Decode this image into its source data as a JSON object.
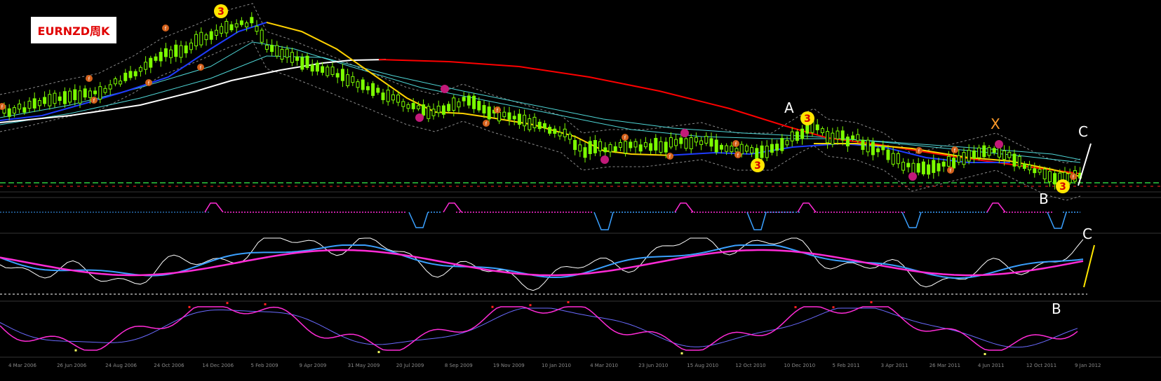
{
  "title": "EURNZD周K",
  "labels": {
    "A": "A",
    "B": "B",
    "C": "C",
    "X": "X",
    "three": "3"
  },
  "colors": {
    "background": "#000000",
    "candle": "#7CFC00",
    "blue_ma": "#1f3cff",
    "yellow_ma": "#ffd200",
    "white_ma": "#ffffff",
    "red_ma": "#ff0000",
    "cyan_band": "#4fd6d6",
    "envelope": "#8a8a8a",
    "hline": "#2ecc40",
    "step_up": "#3aa0ff",
    "step_down": "#ff2bd6",
    "osc_white": "#ffffff",
    "osc_blue": "#3aa0ff",
    "osc_magenta": "#ff2bd6",
    "dot_red": "#ff2020",
    "dot_yellow": "#f5ff60"
  },
  "chart_data": {
    "type": "candlestick",
    "title": "EURNZD周K",
    "x_ticks": [
      "4 Mar 2006",
      "26 Jun 2006",
      "24 Aug 2006",
      "24 Oct 2006",
      "14 Dec 2006",
      "5 Feb 2009",
      "9 Apr 2009",
      "31 May 2009",
      "20 Jul 2009",
      "8 Sep 2009",
      "19 Nov 2009",
      "10 Jan 2010",
      "4 Mar 2010",
      "23 Jun 2010",
      "15 Aug 2010",
      "12 Oct 2010",
      "10 Dec 2010",
      "5 Feb 2011",
      "3 Apr 2011",
      "26 Mar 2011",
      "4 Jun 2011",
      "12 Oct 2011",
      "9 Jan 2012"
    ],
    "annotations": [
      "A",
      "B",
      "C",
      "X",
      "3"
    ]
  }
}
